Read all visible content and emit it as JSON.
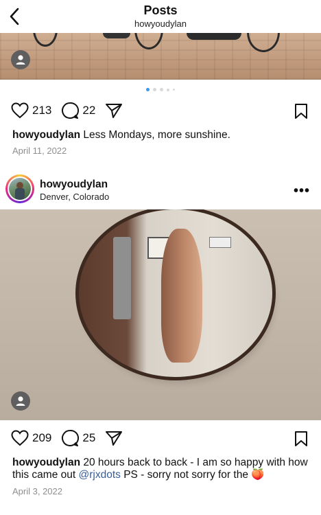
{
  "header": {
    "title": "Posts",
    "subtitle": "howyoudylan"
  },
  "post1": {
    "likes": "213",
    "comments": "22",
    "caption_user": "howyoudylan",
    "caption_text": " Less Mondays, more sunshine.",
    "date": "April 11, 2022",
    "carousel_total": 5,
    "carousel_active": 1
  },
  "post2": {
    "user": "howyoudylan",
    "location": "Denver, Colorado",
    "likes": "209",
    "comments": "25",
    "caption_user": "howyoudylan",
    "caption_text_1": " 20 hours back to back - I am so happy with how this came out ",
    "mention": "@rjxdots",
    "caption_text_2": " PS - sorry not sorry for the ",
    "emoji": "🍑",
    "date": "April 3, 2022"
  },
  "colors": {
    "accent": "#3897f0",
    "mention": "#375d9a",
    "date": "#8e8e8e"
  },
  "icons": [
    "back-chevron-icon",
    "heart-icon",
    "comment-icon",
    "share-icon",
    "bookmark-icon",
    "more-icon",
    "user-tag-icon"
  ]
}
